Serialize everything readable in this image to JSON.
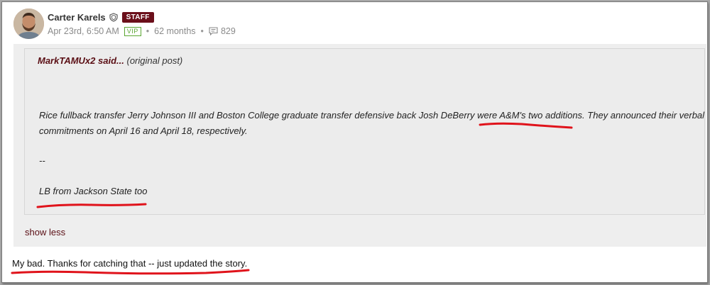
{
  "post": {
    "author": "Carter Karels",
    "badge": "STAFF",
    "date": "Apr 23rd, 6:50 AM",
    "vip": "VIP",
    "tenure": "62 months",
    "comment_count": "829"
  },
  "quote": {
    "author": "MarkTAMUx2",
    "said": "said...",
    "original": "(original post)",
    "line1": "Rice fullback transfer Jerry Johnson III and Boston College graduate transfer defensive back Josh DeBerry were A&M's two additions. They announced their verbal",
    "line2": "commitments on April 16 and April 18, respectively.",
    "separator": "--",
    "line3": "LB from Jackson State too"
  },
  "show_less": "show less",
  "reply": "My bad. Thanks for catching that -- just updated the story.",
  "colors": {
    "badge": "#6b0f1a",
    "link": "#5a0e14",
    "vip": "#5aa632",
    "underline": "#e0131b"
  }
}
